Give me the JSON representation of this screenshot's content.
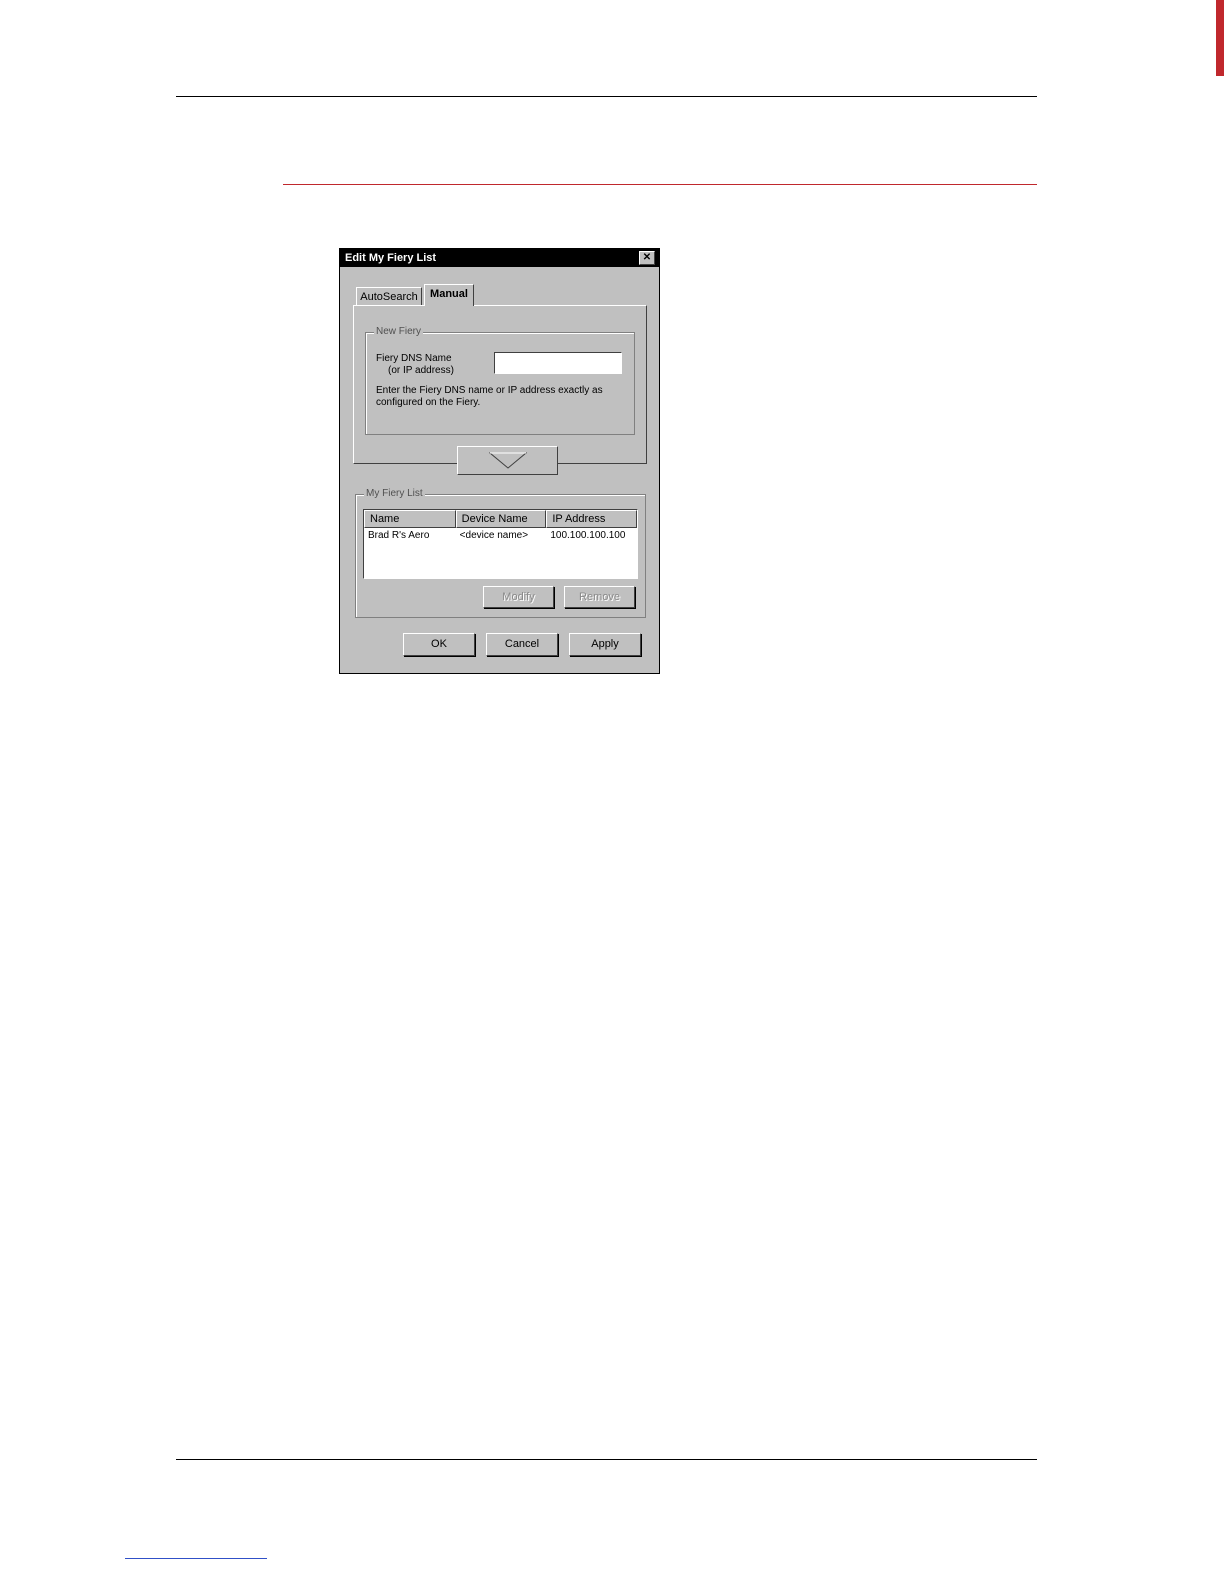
{
  "dialog": {
    "title": "Edit My Fiery List",
    "close_glyph": "✕",
    "tabs": [
      {
        "label": "AutoSearch",
        "active": false
      },
      {
        "label": "Manual",
        "active": true
      }
    ],
    "new_fiery": {
      "legend": "New Fiery",
      "dns_label_line1": "Fiery DNS Name",
      "dns_label_line2": "(or IP address)",
      "dns_value": "",
      "help_line1": "Enter the Fiery DNS name or IP address exactly as",
      "help_line2": "configured on the Fiery."
    },
    "add_button_icon": "down-triangle-icon",
    "my_fiery_list": {
      "legend": "My Fiery List",
      "columns": [
        "Name",
        "Device Name",
        "IP Address"
      ],
      "rows": [
        {
          "name": "Brad R's Aero",
          "device_name": "<device name>",
          "ip_address": "100.100.100.100"
        }
      ],
      "modify_label": "Modify",
      "remove_label": "Remove"
    },
    "ok_label": "OK",
    "cancel_label": "Cancel",
    "apply_label": "Apply"
  }
}
